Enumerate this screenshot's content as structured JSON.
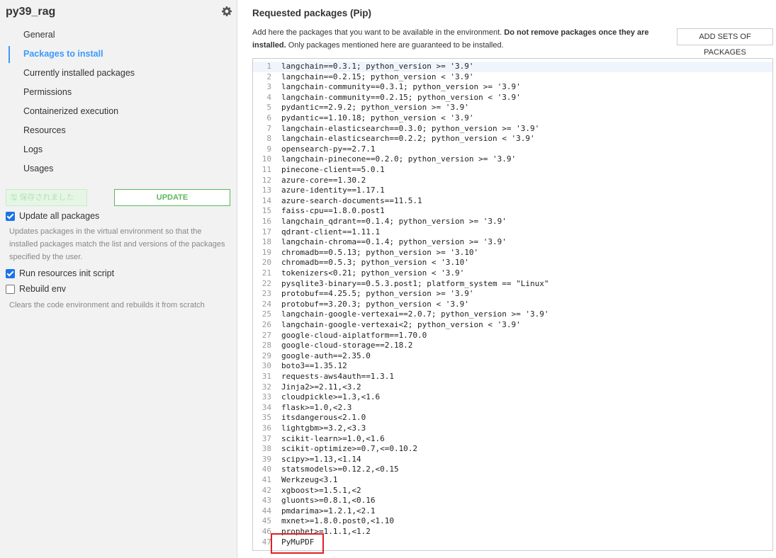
{
  "sidebar": {
    "env_name": "py39_rag",
    "gear_icon": "gear-icon",
    "nav": [
      {
        "label": "General",
        "active": false
      },
      {
        "label": "Packages to install",
        "active": true
      },
      {
        "label": "Currently installed packages",
        "active": false
      },
      {
        "label": "Permissions",
        "active": false
      },
      {
        "label": "Containerized execution",
        "active": false
      },
      {
        "label": "Resources",
        "active": false
      },
      {
        "label": "Logs",
        "active": false
      },
      {
        "label": "Usages",
        "active": false
      }
    ],
    "saved_label": "保存されました",
    "update_label": "UPDATE",
    "update_all": {
      "label": "Update all packages",
      "checked": true
    },
    "update_all_help": "Updates packages in the virtual environment so that the installed packages match the list and versions of the packages specified by the user.",
    "run_init": {
      "label": "Run resources init script",
      "checked": true
    },
    "rebuild": {
      "label": "Rebuild env",
      "checked": false
    },
    "rebuild_help": "Clears the code environment and rebuilds it from scratch"
  },
  "main": {
    "title": "Requested packages (Pip)",
    "desc_pre": "Add here the packages that you want to be available in the environment. ",
    "desc_bold": "Do not remove packages once they are installed.",
    "desc_post": " Only packages mentioned here are guaranteed to be installed.",
    "add_sets_label": "ADD SETS OF PACKAGES",
    "lines": [
      "langchain==0.3.1; python_version >= '3.9'",
      "langchain==0.2.15; python_version < '3.9'",
      "langchain-community==0.3.1; python_version >= '3.9'",
      "langchain-community==0.2.15; python_version < '3.9'",
      "pydantic==2.9.2; python_version >= '3.9'",
      "pydantic==1.10.18; python_version < '3.9'",
      "langchain-elasticsearch==0.3.0; python_version >= '3.9'",
      "langchain-elasticsearch==0.2.2; python_version < '3.9'",
      "opensearch-py==2.7.1",
      "langchain-pinecone==0.2.0; python_version >= '3.9'",
      "pinecone-client==5.0.1",
      "azure-core==1.30.2",
      "azure-identity==1.17.1",
      "azure-search-documents==11.5.1",
      "faiss-cpu==1.8.0.post1",
      "langchain_qdrant==0.1.4; python_version >= '3.9'",
      "qdrant-client==1.11.1",
      "langchain-chroma==0.1.4; python_version >= '3.9'",
      "chromadb==0.5.13; python_version >= '3.10'",
      "chromadb==0.5.3; python_version < '3.10'",
      "tokenizers<0.21; python_version < '3.9'",
      "pysqlite3-binary==0.5.3.post1; platform_system == \"Linux\"",
      "protobuf==4.25.5; python_version >= '3.9'",
      "protobuf==3.20.3; python_version < '3.9'",
      "langchain-google-vertexai==2.0.7; python_version >= '3.9'",
      "langchain-google-vertexai<2; python_version < '3.9'",
      "google-cloud-aiplatform==1.70.0",
      "google-cloud-storage==2.18.2",
      "google-auth==2.35.0",
      "boto3==1.35.12",
      "requests-aws4auth==1.3.1",
      "Jinja2>=2.11,<3.2",
      "cloudpickle>=1.3,<1.6",
      "flask>=1.0,<2.3",
      "itsdangerous<2.1.0",
      "lightgbm>=3.2,<3.3",
      "scikit-learn>=1.0,<1.6",
      "scikit-optimize>=0.7,<=0.10.2",
      "scipy>=1.13,<1.14",
      "statsmodels>=0.12.2,<0.15",
      "Werkzeug<3.1",
      "xgboost>=1.5.1,<2",
      "gluonts>=0.8.1,<0.16",
      "pmdarima>=1.2.1,<2.1",
      "mxnet>=1.8.0.post0,<1.10",
      "prophet>=1.1.1,<1.2",
      "PyMuPDF"
    ],
    "highlighted_line": 47
  }
}
